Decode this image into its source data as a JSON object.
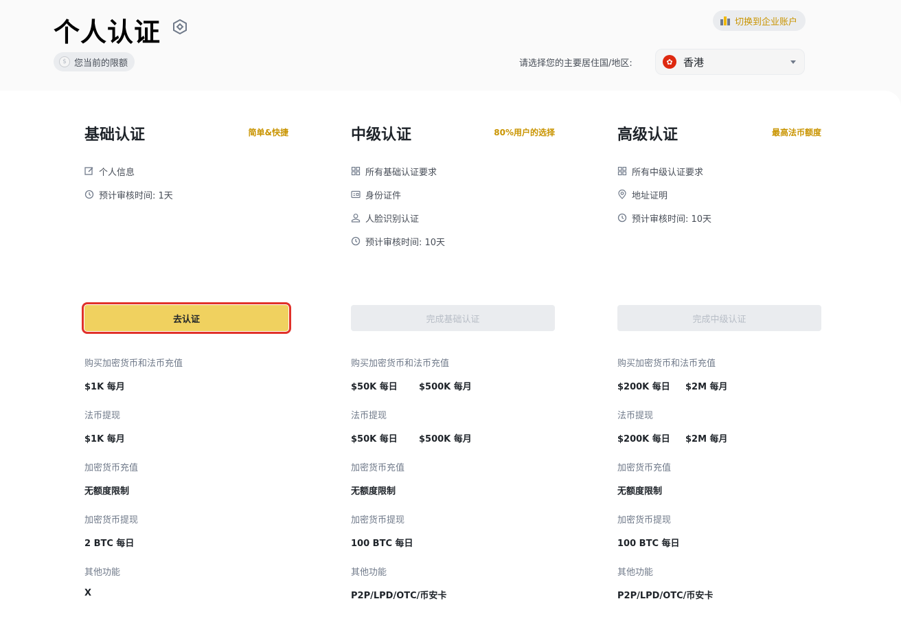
{
  "header": {
    "title": "个人认证",
    "limit_chip": "您当前的限额",
    "switch_button": "切换到企业账户",
    "region_label": "请选择您的主要居住国/地区:",
    "region_value": "香港"
  },
  "colors": {
    "accent": "#c99400",
    "primary_button": "#f0d15f",
    "highlight_border": "#e0312a",
    "disabled_button": "#eaecef"
  },
  "columns": [
    {
      "title": "基础认证",
      "tag": "简单&快捷",
      "requirements": [
        {
          "icon": "edit-icon",
          "text": "个人信息"
        },
        {
          "icon": "clock-icon",
          "text": "预计审核时间: 1天"
        }
      ],
      "button": "去认证",
      "limits": [
        {
          "label": "购买加密货币和法币充值",
          "values": [
            "$1K 每月"
          ]
        },
        {
          "label": "法币提现",
          "values": [
            "$1K 每月"
          ]
        },
        {
          "label": "加密货币充值",
          "values": [
            "无额度限制"
          ]
        },
        {
          "label": "加密货币提现",
          "values": [
            "2 BTC 每日"
          ]
        },
        {
          "label": "其他功能",
          "values": [
            "X"
          ]
        }
      ]
    },
    {
      "title": "中级认证",
      "tag": "80%用户的选择",
      "requirements": [
        {
          "icon": "grid-icon",
          "text": "所有基础认证要求"
        },
        {
          "icon": "id-card-icon",
          "text": "身份证件"
        },
        {
          "icon": "user-icon",
          "text": "人脸识别认证"
        },
        {
          "icon": "clock-icon",
          "text": "预计审核时间: 10天"
        }
      ],
      "button": "完成基础认证",
      "limits": [
        {
          "label": "购买加密货币和法币充值",
          "values": [
            "$50K 每日",
            "$500K 每月"
          ]
        },
        {
          "label": "法币提现",
          "values": [
            "$50K 每日",
            "$500K 每月"
          ]
        },
        {
          "label": "加密货币充值",
          "values": [
            "无额度限制"
          ]
        },
        {
          "label": "加密货币提现",
          "values": [
            "100 BTC 每日"
          ]
        },
        {
          "label": "其他功能",
          "values": [
            "P2P/LPD/OTC/币安卡"
          ]
        }
      ]
    },
    {
      "title": "高级认证",
      "tag": "最高法币额度",
      "requirements": [
        {
          "icon": "grid-icon",
          "text": "所有中级认证要求"
        },
        {
          "icon": "location-icon",
          "text": "地址证明"
        },
        {
          "icon": "clock-icon",
          "text": "预计审核时间: 10天"
        }
      ],
      "button": "完成中级认证",
      "limits": [
        {
          "label": "购买加密货币和法币充值",
          "values": [
            "$200K 每日",
            "$2M 每月"
          ]
        },
        {
          "label": "法币提现",
          "values": [
            "$200K 每日",
            "$2M 每月"
          ]
        },
        {
          "label": "加密货币充值",
          "values": [
            "无额度限制"
          ]
        },
        {
          "label": "加密货币提现",
          "values": [
            "100 BTC 每日"
          ]
        },
        {
          "label": "其他功能",
          "values": [
            "P2P/LPD/OTC/币安卡"
          ]
        }
      ]
    }
  ]
}
